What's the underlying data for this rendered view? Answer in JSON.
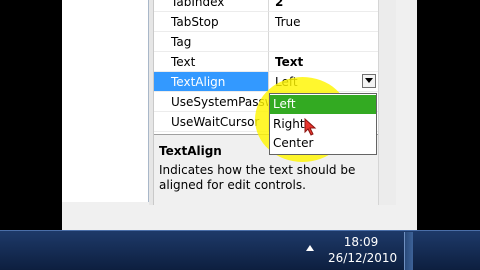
{
  "properties": [
    {
      "name": "TabIndex",
      "value": "2",
      "bold": true
    },
    {
      "name": "TabStop",
      "value": "True",
      "bold": false
    },
    {
      "name": "Tag",
      "value": "",
      "bold": false
    },
    {
      "name": "Text",
      "value": "Text",
      "bold": true
    },
    {
      "name": "TextAlign",
      "value": "Left",
      "bold": false,
      "selected": true
    },
    {
      "name": "UseSystemPasswordChar",
      "value": "",
      "bold": false
    },
    {
      "name": "UseWaitCursor",
      "value": "",
      "bold": false
    }
  ],
  "dropdown": {
    "options": [
      "Left",
      "Right",
      "Center"
    ],
    "selected": "Left"
  },
  "description": {
    "title": "TextAlign",
    "text": "Indicates how the text should be aligned for edit controls."
  },
  "taskbar": {
    "time": "18:09",
    "date": "26/12/2010"
  },
  "icons": {
    "combo": "chevron-down-icon",
    "tray": "tray-up-arrow-icon",
    "cursor": "mouse-cursor-icon"
  },
  "colors": {
    "selection": "#3399ff",
    "option_selected": "#33aa22",
    "highlight": "#fff500",
    "taskbar": "#1e3a6a"
  }
}
